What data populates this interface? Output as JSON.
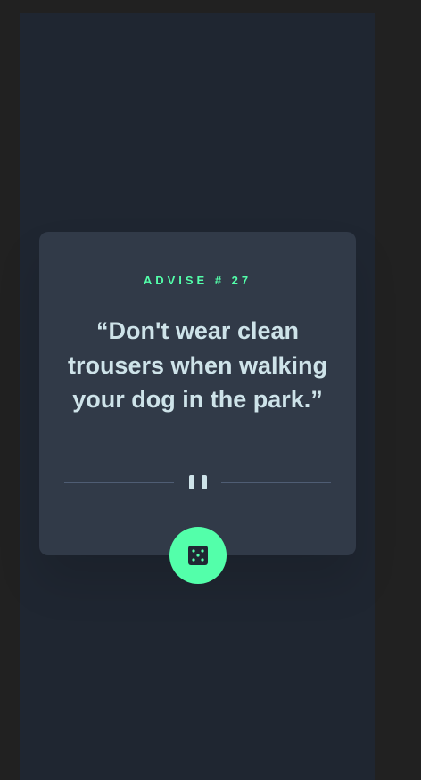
{
  "card": {
    "advice_label": "ADVISE # 27",
    "quote": "“Don't wear clean trousers when walking your dog in the park.”"
  },
  "icons": {
    "divider": "pause-icon",
    "generate": "dice-icon"
  },
  "colors": {
    "accent": "#53ffaa",
    "text": "#cee3e9",
    "card": "#313a48",
    "background": "#1f2631"
  }
}
